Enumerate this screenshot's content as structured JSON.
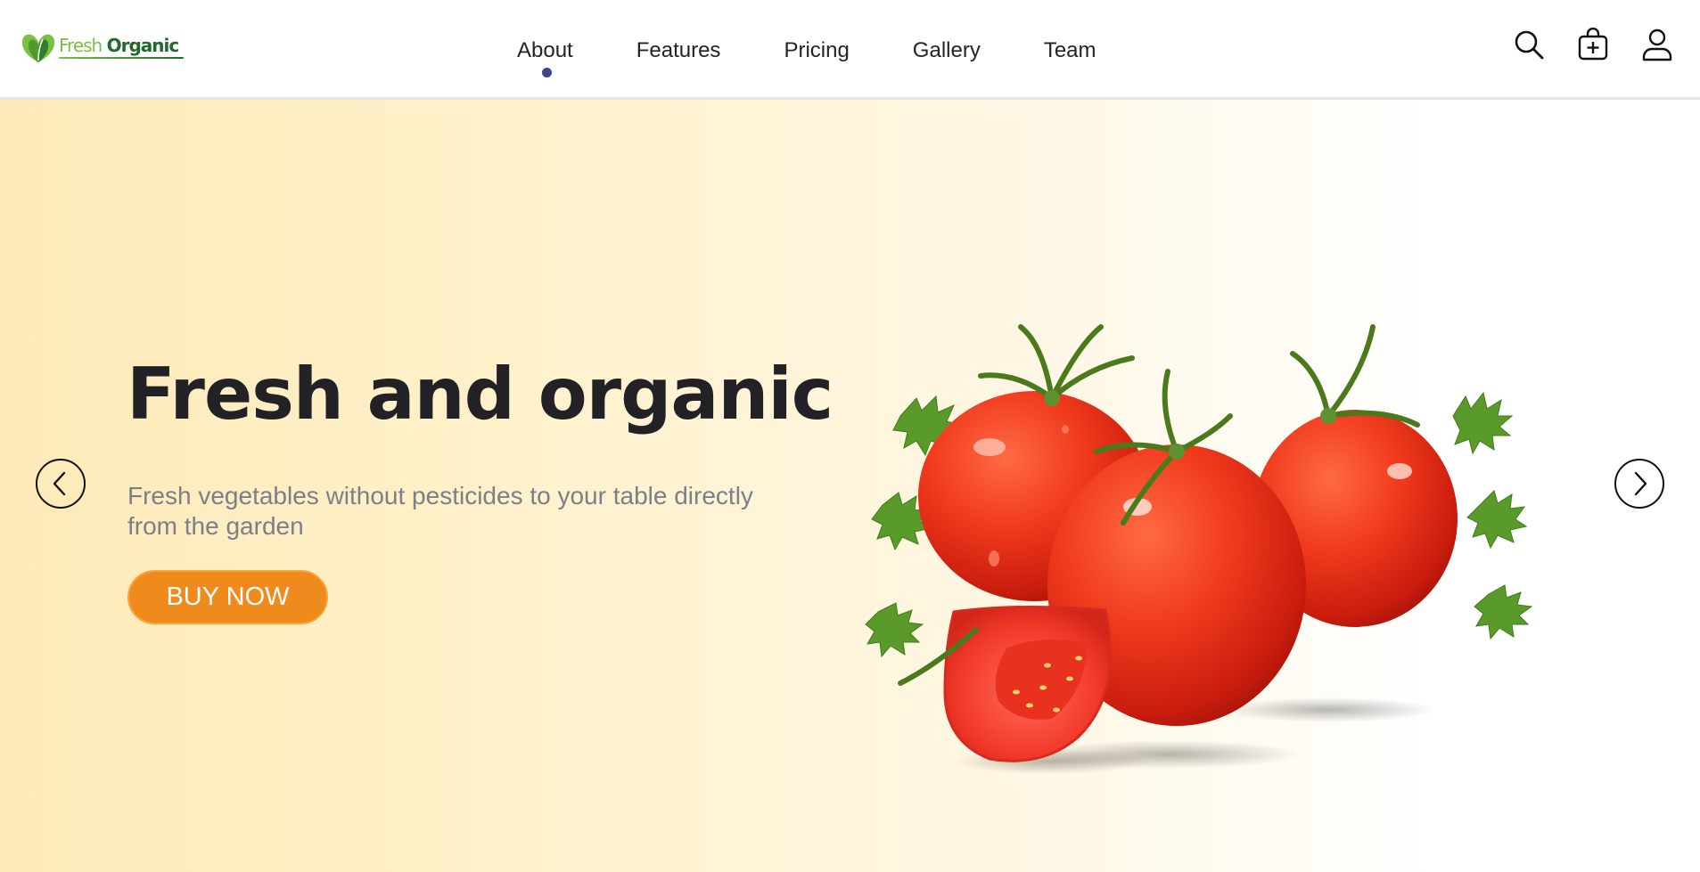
{
  "brand": {
    "name_part1": "Fresh",
    "name_part2": "Organic",
    "colors": {
      "light_green": "#7ac043",
      "dark_green": "#1f6a2c"
    }
  },
  "nav": {
    "items": [
      {
        "label": "About",
        "active": true
      },
      {
        "label": "Features",
        "active": false
      },
      {
        "label": "Pricing",
        "active": false
      },
      {
        "label": "Gallery",
        "active": false
      },
      {
        "label": "Team",
        "active": false
      }
    ],
    "active_indicator_color": "#3e4689"
  },
  "header_icons": [
    "search-icon",
    "cart-add-icon",
    "user-icon"
  ],
  "hero": {
    "title": "Fresh and organic",
    "subtitle": "Fresh vegetables without pesticides to your table directly from the garden",
    "cta_label": "BUY NOW",
    "cta_color": "#ef8a1d",
    "background_start": "#feeab8",
    "image": "tomatoes-with-parsley-illustration"
  },
  "carousel": {
    "prev_icon": "chevron-left-icon",
    "next_icon": "chevron-right-icon"
  }
}
